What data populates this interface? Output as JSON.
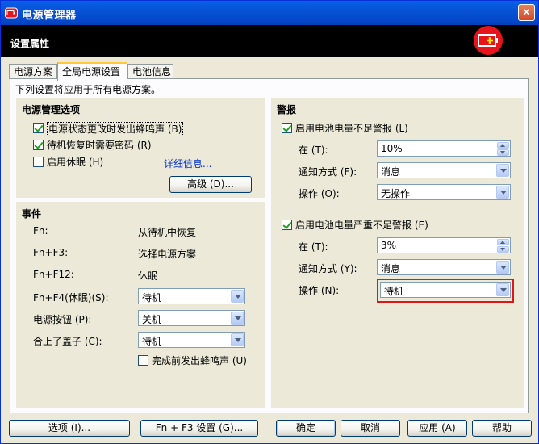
{
  "window": {
    "title": "电源管理器",
    "close_label": "×"
  },
  "header": {
    "title": "设置属性"
  },
  "tabs": [
    {
      "label": "电源方案"
    },
    {
      "label": "全局电源设置"
    },
    {
      "label": "电池信息"
    }
  ],
  "description": "下列设置将应用于所有电源方案。",
  "power_options": {
    "title": "电源管理选项",
    "beep_on_change": {
      "label": "电源状态更改时发出蜂鸣声 (B)",
      "checked": true
    },
    "password_on_resume": {
      "label": "待机恢复时需要密码 (R)",
      "checked": true
    },
    "hibernate": {
      "label": "启用休眠 (H)",
      "checked": false
    },
    "details_link": "详细信息...",
    "advanced_button": "高级 (D)..."
  },
  "events": {
    "title": "事件",
    "fn": {
      "label": "Fn:",
      "value": "从待机中恢复"
    },
    "fn_f3": {
      "label": "Fn+F3:",
      "value": "选择电源方案"
    },
    "fn_f12": {
      "label": "Fn+F12:",
      "value": "休眠"
    },
    "fn_f4": {
      "label": "Fn+F4(休眠)(S):",
      "value": "待机"
    },
    "power_button": {
      "label": "电源按钮 (P):",
      "value": "关机"
    },
    "lid_close": {
      "label": "合上了盖子 (C):",
      "value": "待机"
    },
    "beep_before_done": {
      "label": "完成前发出蜂鸣声 (U)",
      "checked": false
    }
  },
  "alarms": {
    "title": "警报",
    "low": {
      "enable_label": "启用电池电量不足警报 (L)",
      "checked": true,
      "at_label": "在 (T):",
      "at_value": "10%",
      "notify_label": "通知方式 (F):",
      "notify_value": "消息",
      "action_label": "操作 (O):",
      "action_value": "无操作"
    },
    "critical": {
      "enable_label": "启用电池电量严重不足警报 (E)",
      "checked": true,
      "at_label": "在 (T):",
      "at_value": "3%",
      "notify_label": "通知方式 (Y):",
      "notify_value": "消息",
      "action_label": "操作 (N):",
      "action_value": "待机"
    }
  },
  "footer": {
    "options_button": "选项 (I)...",
    "fn_f3_settings_button": "Fn + F3 设置 (G)...",
    "ok_button": "确定",
    "cancel_button": "取消",
    "apply_button": "应用 (A)",
    "help_button": "帮助"
  },
  "colors": {
    "title_bar": "#0653D6",
    "header_bg": "#000000",
    "battery_badge": "#E8141B",
    "highlight": "#E0171A"
  }
}
